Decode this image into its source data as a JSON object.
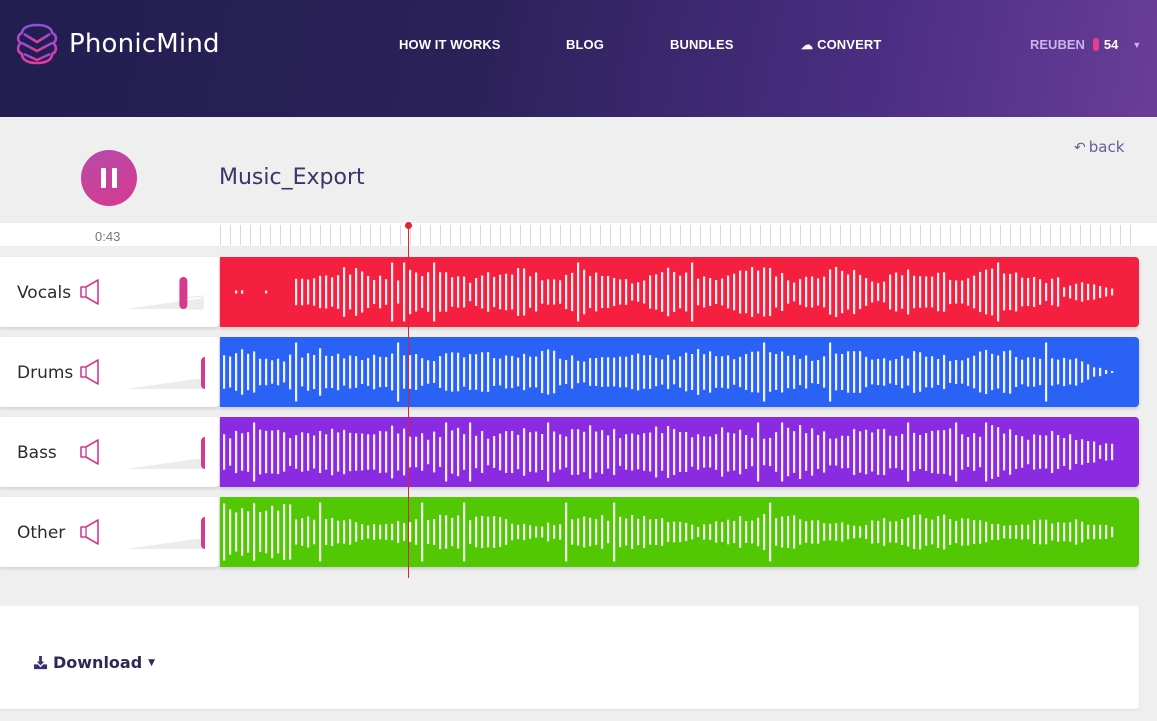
{
  "header": {
    "brand": "PhonicMind",
    "nav": [
      {
        "label": "HOW IT WORKS"
      },
      {
        "label": "BLOG"
      },
      {
        "label": "BUNDLES"
      },
      {
        "label": "CONVERT",
        "icon": "cloud-upload-icon"
      }
    ],
    "user": {
      "name": "REUBEN",
      "credits": "54"
    }
  },
  "player": {
    "state": "playing",
    "title": "Music_Export",
    "back_label": "back",
    "current_time": "0:43",
    "playhead_fraction": 0.205
  },
  "tracks": [
    {
      "name": "Vocals",
      "color": "#f5203f",
      "volume": 0.7,
      "seed": 3,
      "profile": "vocals"
    },
    {
      "name": "Drums",
      "color": "#2a62f5",
      "volume": 1.0,
      "seed": 7,
      "profile": "drums"
    },
    {
      "name": "Bass",
      "color": "#8a2be2",
      "volume": 1.0,
      "seed": 11,
      "profile": "bass"
    },
    {
      "name": "Other",
      "color": "#52c804",
      "volume": 1.0,
      "seed": 17,
      "profile": "other"
    }
  ],
  "download": {
    "label": "Download"
  },
  "colors": {
    "accent": "#d63a8f",
    "playhead": "#e0242e",
    "title": "#3b3566"
  }
}
